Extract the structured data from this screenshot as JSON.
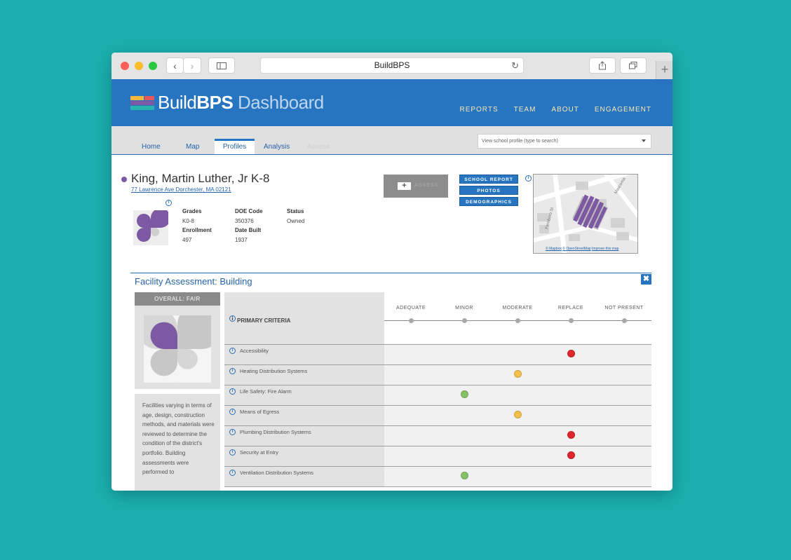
{
  "browser": {
    "address": "BuildBPS"
  },
  "brand": {
    "part1": "Build",
    "part2": "BPS",
    "part3": " Dashboard"
  },
  "topnav": [
    "REPORTS",
    "TEAM",
    "ABOUT",
    "ENGAGEMENT"
  ],
  "tabs": [
    "Home",
    "Map",
    "Profiles",
    "Analysis",
    "Assess"
  ],
  "search": {
    "placeholder": "View school profile (type to search)"
  },
  "school": {
    "name": "King, Martin Luther, Jr K-8",
    "address": "77 Lawrence Ave Dorchester, MA 02121",
    "attrs": [
      {
        "label": "Grades",
        "value": "K0-8"
      },
      {
        "label": "DOE Code",
        "value": "350376"
      },
      {
        "label": "Status",
        "value": "Owned"
      },
      {
        "label": "Enrollment",
        "value": "497"
      },
      {
        "label": "Date Built",
        "value": "1937"
      }
    ]
  },
  "buttons": {
    "school_report": "SCHOOL REPORT",
    "photos": "PHOTOS",
    "demographics": "DEMOGRAPHICS",
    "add_label": "ASSESS"
  },
  "map": {
    "streets": [
      "Fernboro St",
      "Mascoma"
    ],
    "attribution": [
      "© Mapbox",
      "© OpenStreetMap",
      "Improve this map"
    ]
  },
  "assessment": {
    "title": "Facility Assessment: Building",
    "overall": "OVERALL: FAIR",
    "description": "Facilities varying in terms of age, design, construction methods, and materials were reviewed to determine the condition of the district's portfolio. Building assessments were performed to",
    "header_label": "PRIMARY CRITERIA",
    "columns": [
      "ADEQUATE",
      "MINOR",
      "MODERATE",
      "REPLACE",
      "NOT PRESENT"
    ],
    "rating_colors": {
      "adequate": "#86c167",
      "moderate": "#f2c04a",
      "replace": "#e0262e"
    },
    "rows": [
      {
        "label": "Accessibility",
        "rating": "REPLACE"
      },
      {
        "label": "Heating Distribution Systems",
        "rating": "MODERATE"
      },
      {
        "label": "Life Safety: Fire Alarm",
        "rating": "MINOR"
      },
      {
        "label": "Means of Egress",
        "rating": "MODERATE"
      },
      {
        "label": "Plumbing Distribution Systems",
        "rating": "REPLACE"
      },
      {
        "label": "Security at Entry",
        "rating": "REPLACE"
      },
      {
        "label": "Ventilation Distribution Systems",
        "rating": "MINOR"
      }
    ]
  }
}
